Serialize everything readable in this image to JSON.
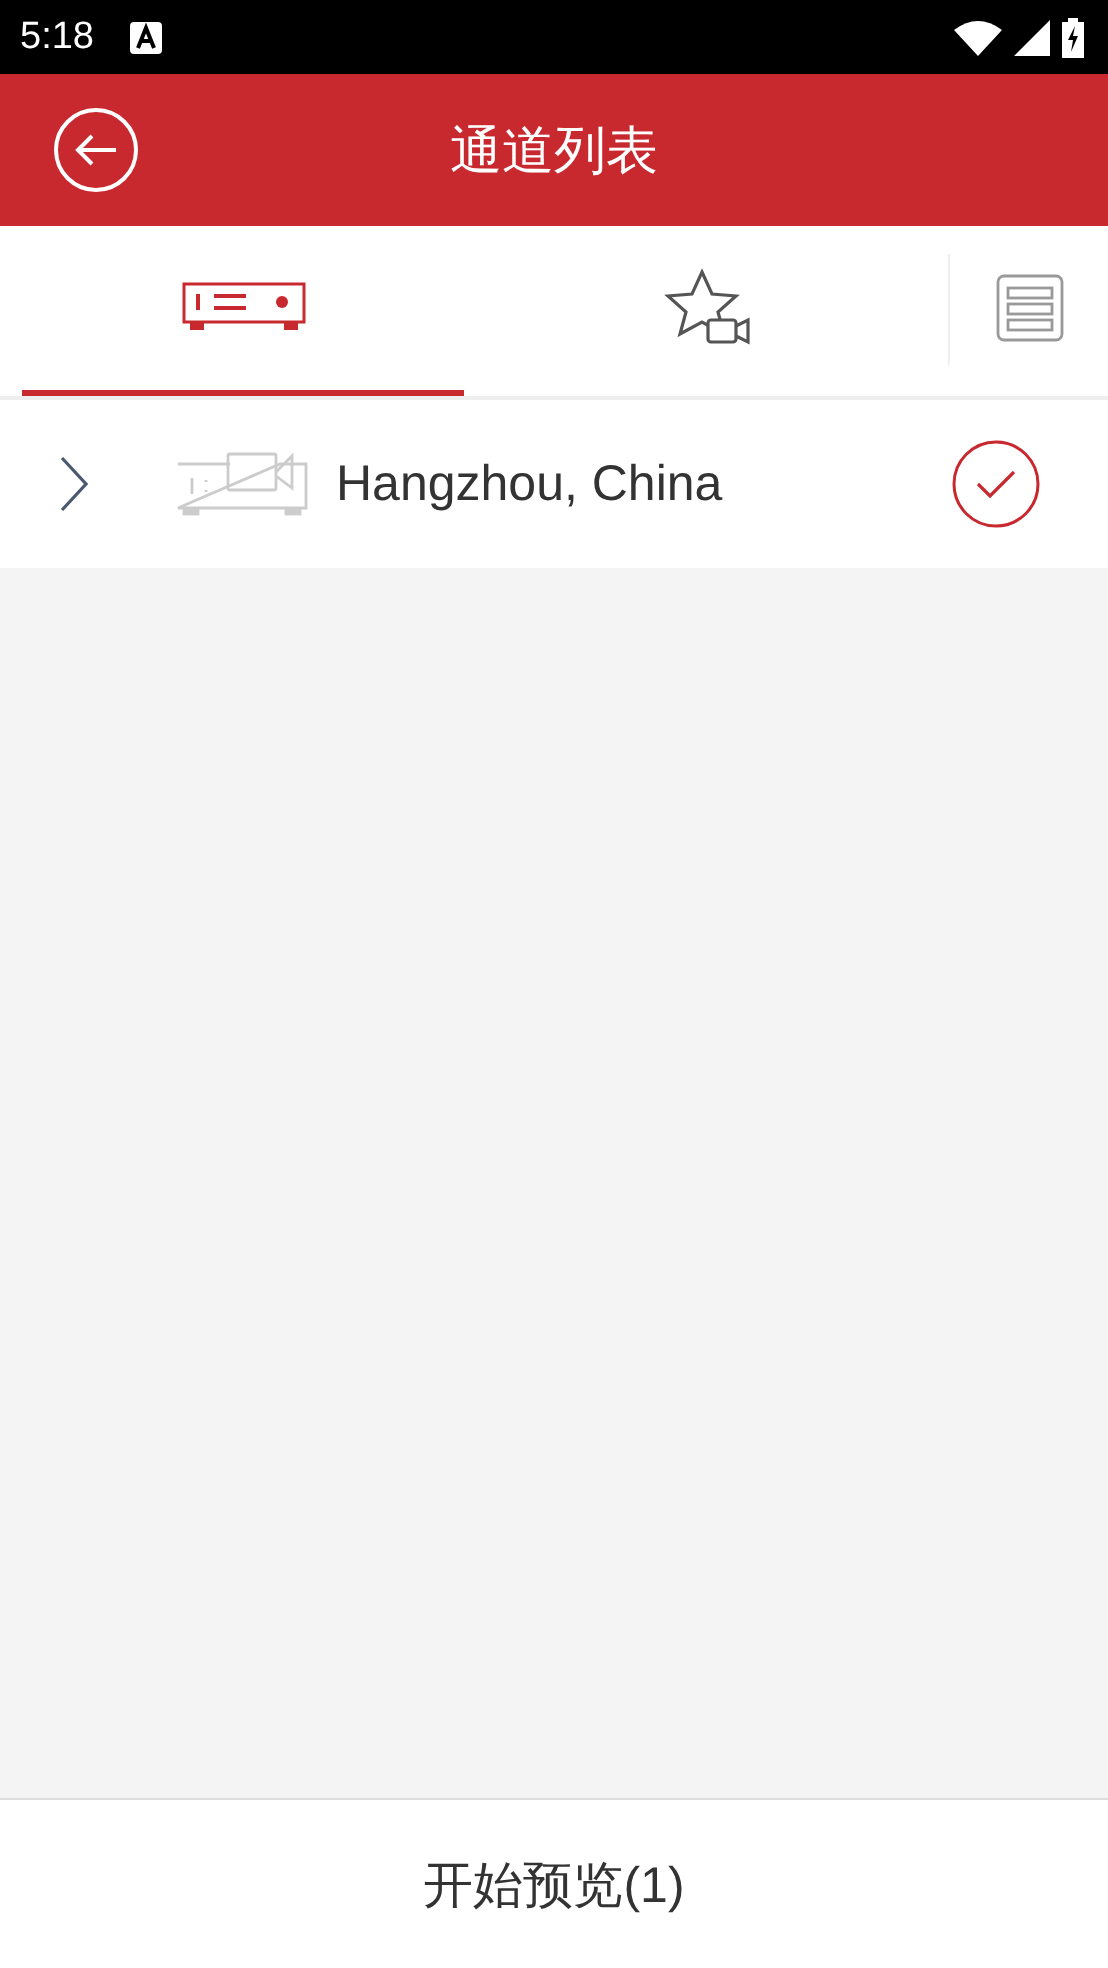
{
  "status_bar": {
    "time": "5:18"
  },
  "header": {
    "title": "通道列表"
  },
  "tabs": [
    {
      "kind": "device",
      "selected": true
    },
    {
      "kind": "favorite",
      "selected": false
    },
    {
      "kind": "list",
      "selected": false
    }
  ],
  "channels": [
    {
      "name": "Hangzhou, China",
      "expanded": false,
      "checked": true
    }
  ],
  "footer": {
    "button": "开始预览(1)"
  }
}
